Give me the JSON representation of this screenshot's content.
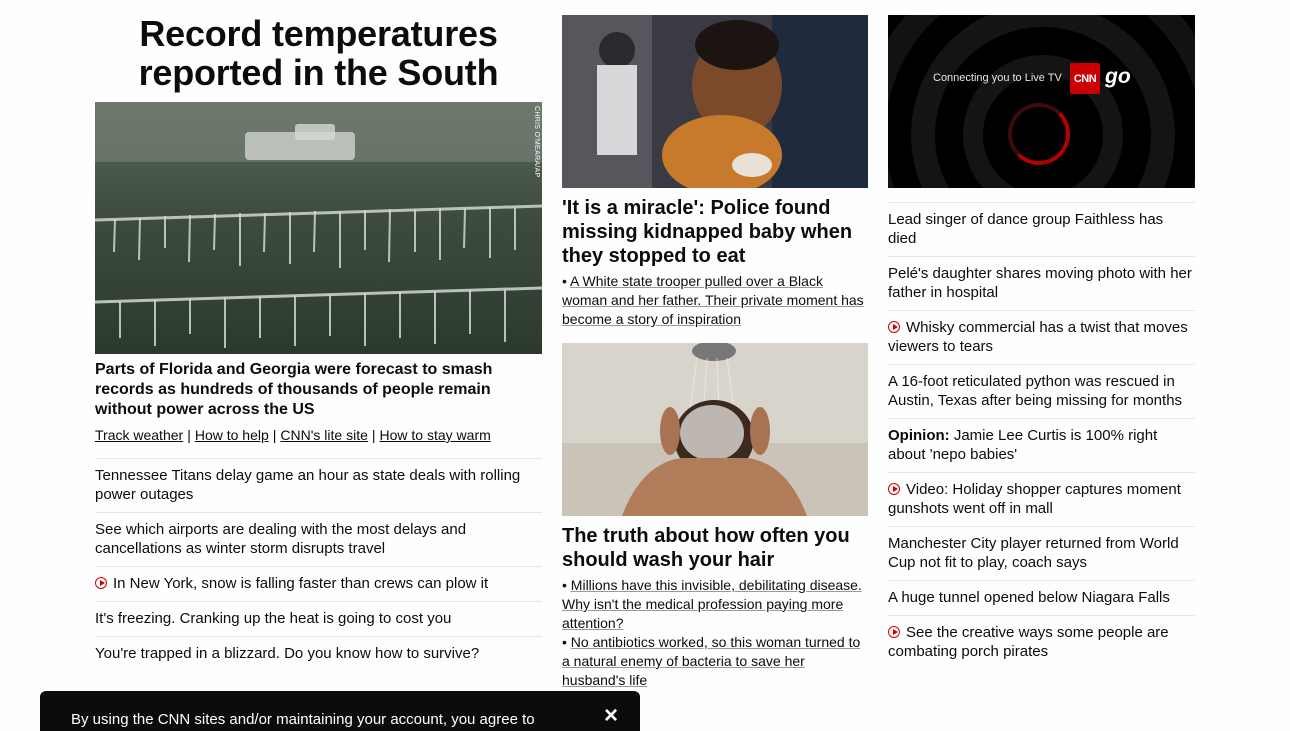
{
  "lead": {
    "headline": "Record temperatures reported in the South",
    "image_credit": "CHRIS O'MEARA/AP",
    "title": "Parts of Florida and Georgia were forecast to smash records as hundreds of thousands of people remain without power across the US",
    "links": [
      "Track weather",
      "How to help",
      "CNN's lite site",
      "How to stay warm"
    ],
    "separator": "|"
  },
  "left_list": [
    {
      "text": "Tennessee Titans delay game an hour as state deals with rolling power outages",
      "video": false
    },
    {
      "text": "See which airports are dealing with the most delays and cancellations as winter storm disrupts travel",
      "video": false
    },
    {
      "text": "In New York, snow is falling faster than crews can plow it",
      "video": true
    },
    {
      "text": "It's freezing. Cranking up the heat is going to cost you",
      "video": false
    },
    {
      "text": "You're trapped in a blizzard. Do you know how to survive?",
      "video": false
    }
  ],
  "card1": {
    "title": "'It is a miracle': Police found missing kidnapped baby when they stopped to eat",
    "bullets": [
      "A White state trooper pulled over a Black woman and her father. Their private moment has become a story of inspiration"
    ]
  },
  "card2": {
    "title": "The truth about how often you should wash your hair",
    "bullets": [
      "Millions have this invisible, debilitating disease. Why isn't the medical profession paying more attention?",
      "No antibiotics worked, so this woman turned to a natural enemy of bacteria to save her husband's life"
    ]
  },
  "live_tv": {
    "connecting_text": "Connecting you to Live TV",
    "logo_text": "CNN",
    "go_text": "go"
  },
  "right_list": [
    {
      "prefix": "",
      "text": "Lead singer of dance group Faithless has died",
      "video": false
    },
    {
      "prefix": "",
      "text": "Pelé's daughter shares moving photo with her father in hospital",
      "video": false
    },
    {
      "prefix": "",
      "text": "Whisky commercial has a twist that moves viewers to tears",
      "video": true
    },
    {
      "prefix": "",
      "text": "A 16-foot reticulated python was rescued in Austin, Texas after being missing for months",
      "video": false
    },
    {
      "prefix": "Opinion:",
      "text": "Jamie Lee Curtis is 100% right about 'nepo babies'",
      "video": false
    },
    {
      "prefix": "",
      "text": "Video: Holiday shopper captures moment gunshots went off in mall",
      "video": true
    },
    {
      "prefix": "",
      "text": "Manchester City player returned from World Cup not fit to play, coach says",
      "video": false
    },
    {
      "prefix": "",
      "text": "A huge tunnel opened below Niagara Falls",
      "video": false
    },
    {
      "prefix": "",
      "text": "See the creative ways some people are combating porch pirates",
      "video": true
    }
  ],
  "consent": {
    "text": "By using the CNN sites and/or maintaining your account, you agree to",
    "close_icon": "×"
  },
  "colors": {
    "accent": "#cc0000",
    "text": "#0c0c0c",
    "divider": "#e6e6e6"
  }
}
